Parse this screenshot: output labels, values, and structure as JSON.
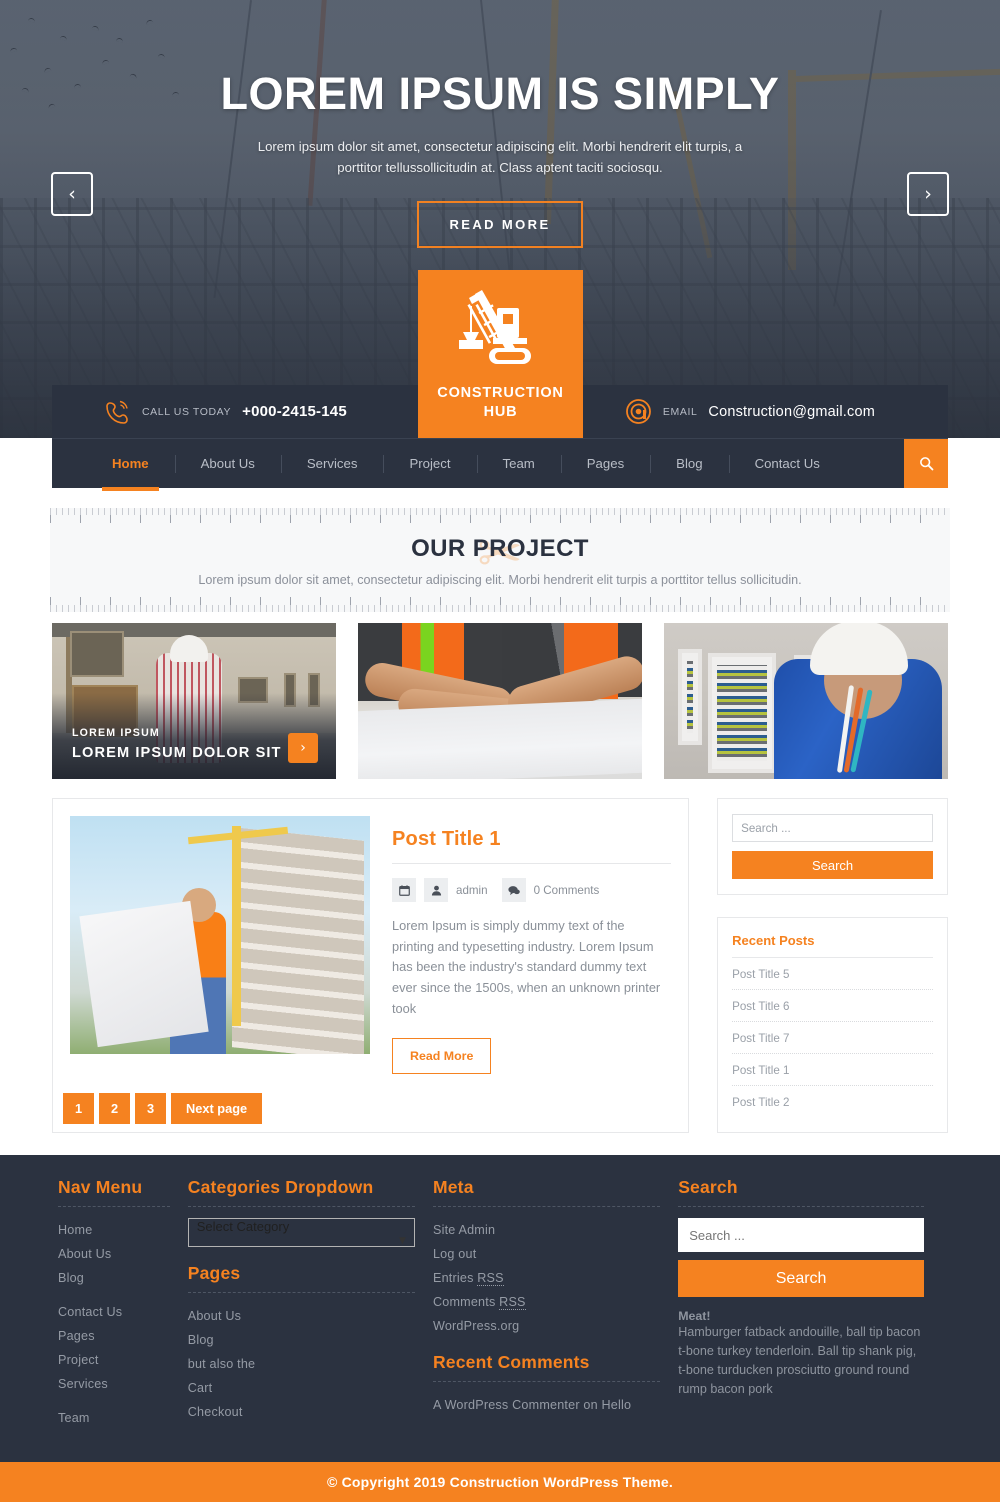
{
  "hero": {
    "title": "LOREM IPSUM IS SIMPLY",
    "subtitle": "Lorem ipsum dolor sit amet, consectetur adipiscing elit. Morbi hendrerit elit turpis, a porttitor tellussollicitudin at. Class aptent taciti sociosqu.",
    "button_label": "READ MORE",
    "prev_icon": "chevron-left-icon",
    "next_icon": "chevron-right-icon",
    "prev_glyph": "‹",
    "next_glyph": "›"
  },
  "logo": {
    "name_line1": "CONSTRUCTION",
    "name_line2": "HUB",
    "icon": "crane-icon",
    "bg_color": "#f58220"
  },
  "topbar": {
    "phone_icon": "phone-icon",
    "phone_label": "CALL US TODAY",
    "phone_value": "+000-2415-145",
    "email_icon": "at-sign-icon",
    "email_label": "EMAIL",
    "email_value": "Construction@gmail.com",
    "bg_color": "#2b3240"
  },
  "nav": {
    "items": [
      {
        "label": "Home",
        "active": true
      },
      {
        "label": "About Us",
        "active": false
      },
      {
        "label": "Services",
        "active": false
      },
      {
        "label": "Project",
        "active": false
      },
      {
        "label": "Team",
        "active": false
      },
      {
        "label": "Pages",
        "active": false
      },
      {
        "label": "Blog",
        "active": false
      },
      {
        "label": "Contact Us",
        "active": false
      }
    ],
    "search_icon": "search-icon",
    "accent_color": "#f58220"
  },
  "section": {
    "title": "OUR PROJECT",
    "subtitle": "Lorem ipsum dolor sit amet, consectetur adipiscing elit. Morbi hendrerit elit turpis a porttitor tellus sollicitudin.",
    "watermark": "✂"
  },
  "projects": [
    {
      "kicker": "LOREM IPSUM",
      "name": "LOREM IPSUM DOLOR SIT",
      "arrow_glyph": "›",
      "has_caption": true
    },
    {
      "kicker": "",
      "name": "",
      "arrow_glyph": "›",
      "has_caption": false
    },
    {
      "kicker": "",
      "name": "",
      "arrow_glyph": "›",
      "has_caption": false
    }
  ],
  "post": {
    "title": "Post Title 1",
    "date_icon": "calendar-icon",
    "author_icon": "user-icon",
    "author": "admin",
    "comments_icon": "comment-icon",
    "comments": "0 Comments",
    "excerpt": "Lorem Ipsum is simply dummy text of the printing and typesetting industry. Lorem Ipsum has been the industry's standard dummy text ever since the 1500s, when an unknown printer took",
    "read_more": "Read More"
  },
  "sidebar": {
    "search_placeholder": "Search ...",
    "search_button": "Search",
    "recent_posts_title": "Recent Posts",
    "recent_posts": [
      "Post Title 5",
      "Post Title 6",
      "Post Title 7",
      "Post Title 1",
      "Post Title 2"
    ]
  },
  "pagination": {
    "pages": [
      "1",
      "2",
      "3"
    ],
    "next_label": "Next page"
  },
  "footer": {
    "nav_menu": {
      "title": "Nav Menu",
      "items": [
        "Home",
        "About Us",
        "Blog",
        "Contact Us",
        "Pages",
        "Project",
        "Services",
        "Team"
      ]
    },
    "categories": {
      "title": "Categories Dropdown",
      "selected": "Select Category",
      "chevron_icon": "chevron-down-icon"
    },
    "pages": {
      "title": "Pages",
      "items": [
        "About Us",
        "Blog",
        "but also the",
        "Cart",
        "Checkout"
      ]
    },
    "meta": {
      "title": "Meta",
      "items": [
        {
          "text": "Site Admin",
          "abbr": ""
        },
        {
          "text": "Log out",
          "abbr": ""
        },
        {
          "text": "Entries ",
          "abbr": "RSS"
        },
        {
          "text": "Comments ",
          "abbr": "RSS"
        },
        {
          "text": "WordPress.org",
          "abbr": ""
        }
      ]
    },
    "recent_comments": {
      "title": "Recent Comments",
      "items": [
        "A WordPress Commenter on Hello"
      ]
    },
    "search": {
      "title": "Search",
      "placeholder": "Search ...",
      "button": "Search",
      "meat_title": "Meat!",
      "meat_text": "Hamburger fatback andouille, ball tip bacon t-bone turkey tenderloin. Ball tip shank pig, t-bone turducken prosciutto ground round rump bacon pork"
    }
  },
  "copyright": {
    "text": "© Copyright 2019 Construction WordPress Theme.",
    "bg_color": "#f58220"
  }
}
